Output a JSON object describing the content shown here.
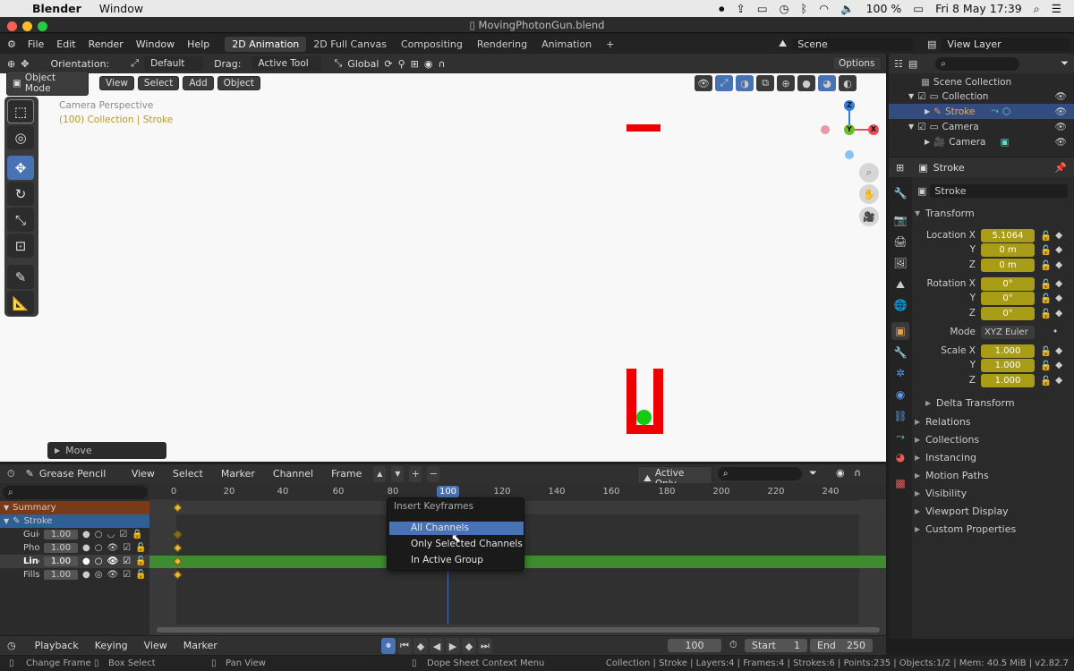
{
  "macbar": {
    "app": "Blender",
    "menu": "Window",
    "battery": "100 %",
    "clock": "Fri 8 May  17:39"
  },
  "window_title": "MovingPhotonGun.blend",
  "topbar": {
    "menus": [
      "File",
      "Edit",
      "Render",
      "Window",
      "Help"
    ],
    "workspaces": [
      "2D Animation",
      "2D Full Canvas",
      "Compositing",
      "Rendering",
      "Animation"
    ],
    "add_symbol": "+",
    "scene": "Scene",
    "view_layer": "View Layer"
  },
  "tool_header": {
    "orientation_label": "Orientation:",
    "orientation": "Default",
    "drag_label": "Drag:",
    "drag": "Active Tool",
    "transform": "Global",
    "options": "Options"
  },
  "viewport_header": {
    "mode": "Object Mode",
    "menus": [
      "View",
      "Select",
      "Add",
      "Object"
    ]
  },
  "viewport": {
    "camera_label": "Camera Perspective",
    "collection_label": "(100) Collection | Stroke",
    "operator": "Move"
  },
  "gizmo": {
    "z": "Z",
    "y": "Y",
    "x": "X"
  },
  "outliner": {
    "rows": [
      {
        "label": "Scene Collection"
      },
      {
        "label": "Collection"
      },
      {
        "label": "Stroke"
      },
      {
        "label": "Camera"
      },
      {
        "label": "Camera"
      }
    ]
  },
  "properties": {
    "object": "Stroke",
    "name_field": "Stroke",
    "transform_title": "Transform",
    "location": {
      "label_x": "Location X",
      "x": "5.1064",
      "y": "0 m",
      "z": "0 m"
    },
    "rotation": {
      "label_x": "Rotation X",
      "x": "0°",
      "y": "0°",
      "z": "0°"
    },
    "mode_label": "Mode",
    "mode": "XYZ Euler",
    "scale": {
      "label_x": "Scale X",
      "x": "1.000",
      "y": "1.000",
      "z": "1.000"
    },
    "axis_y": "Y",
    "axis_z": "Z",
    "delta": "Delta Transform",
    "panels": [
      "Relations",
      "Collections",
      "Instancing",
      "Motion Paths",
      "Visibility",
      "Viewport Display",
      "Custom Properties"
    ]
  },
  "dopesheet_header": {
    "mode": "Grease Pencil",
    "menus": [
      "View",
      "Select",
      "Marker",
      "Channel",
      "Frame"
    ],
    "active_only": "Active Only"
  },
  "channels": {
    "summary": "Summary",
    "object": "Stroke",
    "layers": [
      {
        "name": "Guic",
        "opacity": "1.00"
      },
      {
        "name": "Pho",
        "opacity": "1.00"
      },
      {
        "name": "Line",
        "opacity": "1.00"
      },
      {
        "name": "Fills",
        "opacity": "1.00"
      }
    ]
  },
  "ruler": {
    "ticks": [
      "0",
      "20",
      "40",
      "60",
      "80",
      "120",
      "140",
      "160",
      "180",
      "200",
      "220",
      "240"
    ],
    "current_frame": "100"
  },
  "context_menu": {
    "title": "Insert Keyframes",
    "items": [
      "All Channels",
      "Only Selected Channels",
      "In Active Group"
    ]
  },
  "timeline": {
    "menus": [
      "Playback",
      "Keying",
      "View",
      "Marker"
    ],
    "frame": "100",
    "start_label": "Start",
    "start": "1",
    "end_label": "End",
    "end": "250"
  },
  "statusbar": {
    "hints": [
      "Change Frame",
      "Box Select",
      "Pan View",
      "Dope Sheet Context Menu"
    ],
    "stats": "Collection | Stroke | Layers:4 | Frames:4 | Strokes:6 | Points:235 | Objects:1/2 | Mem: 40.5 MiB | v2.82.7"
  }
}
